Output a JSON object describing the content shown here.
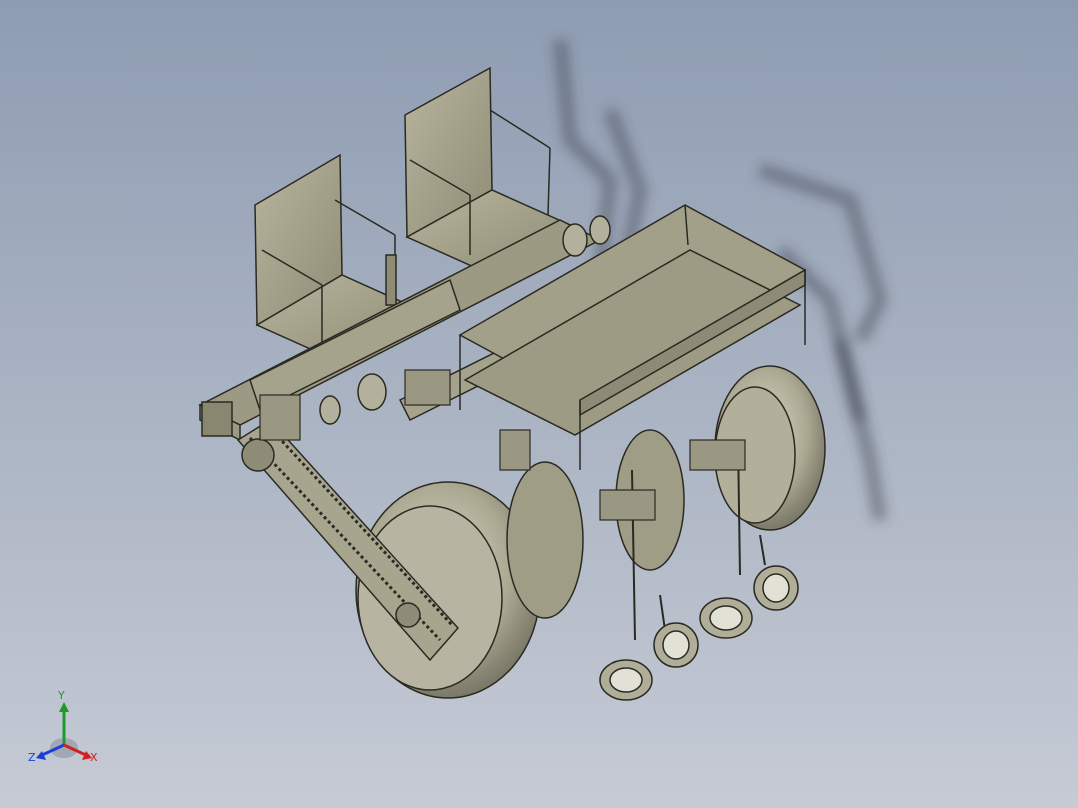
{
  "viewport": {
    "background_top": "#8e9cb2",
    "background_bottom": "#c6cbd5",
    "model_color": "#a8a58f",
    "edge_color": "#2a2a22"
  },
  "triad": {
    "x_label": "X",
    "y_label": "Y",
    "z_label": "Z",
    "x_color": "#d02020",
    "y_color": "#1f9a2a",
    "z_color": "#1d3fd6"
  }
}
